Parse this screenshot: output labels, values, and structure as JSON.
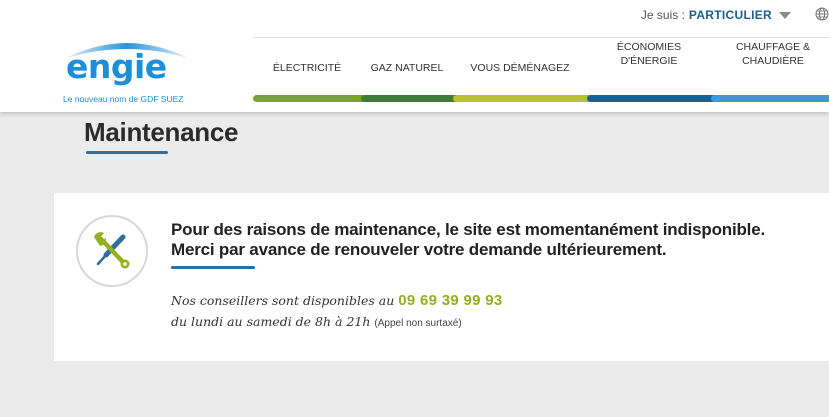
{
  "topbar": {
    "iam_label": "Je suis :",
    "profile": "PARTICULIER"
  },
  "logo": {
    "wordmark": "engie",
    "tagline": "Le nouveau nom de GDF SUEZ"
  },
  "nav": {
    "items": [
      {
        "line1": "ÉLECTRICITÉ",
        "line2": "",
        "color": "#7aa32a"
      },
      {
        "line1": "GAZ NATUREL",
        "line2": "",
        "color": "#3f7c3a"
      },
      {
        "line1": "VOUS DÉMÉNAGEZ",
        "line2": "",
        "color": "#b8c22a"
      },
      {
        "line1": "ÉCONOMIES",
        "line2": "D'ÉNERGIE",
        "color": "#1d5f8a"
      },
      {
        "line1": "CHAUFFAGE &",
        "line2": "CHAUDIÈRE",
        "color": "#3a9ad8"
      }
    ]
  },
  "page": {
    "title": "Maintenance"
  },
  "notice": {
    "line1": "Pour des raisons de maintenance, le site est momentanément indisponible.",
    "line2": "Merci par avance de renouveler votre demande ultérieurement.",
    "advisors_text": "Nos conseillers sont disponibles au",
    "phone": "09 69 39 99 93",
    "hours_text": "du lundi au samedi de 8h à 21h",
    "hours_note": "(Appel non surtaxé)"
  },
  "colors": {
    "brand_blue": "#1d8fd6",
    "accent_green": "#94b022",
    "underline_blue": "#2e6f9e"
  },
  "icons": {
    "globe": "globe-icon",
    "tools": "wrench-screwdriver-icon"
  }
}
